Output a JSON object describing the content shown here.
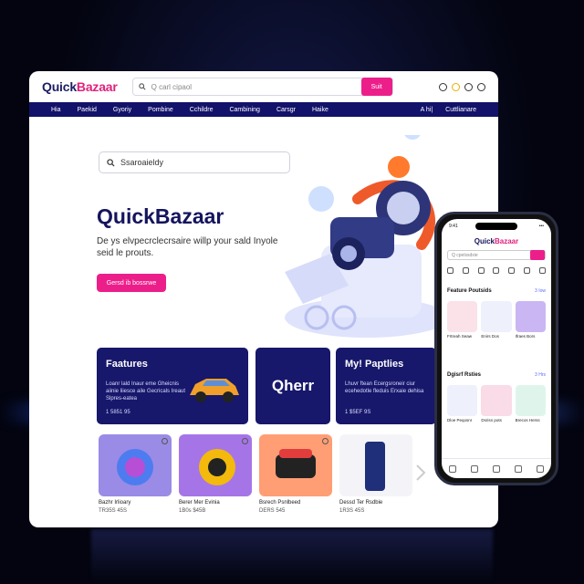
{
  "brand": {
    "name_dark": "Quick",
    "name_pink": "Bazaar",
    "accent": "#ec1f8a",
    "navy": "#17176b"
  },
  "topbar": {
    "search_placeholder": "Q carl cipaol",
    "search_button": "Suit",
    "icons": [
      "user-icon",
      "lightbulb-icon",
      "cart-icon",
      "help-icon"
    ]
  },
  "nav": {
    "items": [
      "Hia",
      "Paekid",
      "Gyoriy",
      "Pombine",
      "Cchildre",
      "Cambining",
      "Carsgr",
      "Haike"
    ],
    "right": [
      "A hi|",
      "Cuttlianare"
    ]
  },
  "hero": {
    "search_text": "Ssaroaieldy",
    "title": "QuickBazaar",
    "subtitle": "De ys elvpecrclecrsaire willp your sald Inyole seid le prouts.",
    "button": "Gersd ib bossrwe"
  },
  "features": [
    {
      "title": "Faatures",
      "text": "Loanr lald Inaur eme Gheicnis aiinie liiesce aile Gecricals Ireaut Slpres-eatea",
      "meta": "1 5851 95"
    },
    {
      "title": "Qherr"
    },
    {
      "title": "My! Paptlies",
      "text": "Lhuvr ftean Ecergsroneir ciur ecehedotle fleduis Erxaie dehisa",
      "meta": "1 $5EF 9S"
    }
  ],
  "products": [
    {
      "title": "Bazhr Irlioary",
      "price": "TR35S 45S",
      "color": "#9a8be6"
    },
    {
      "title": "Berer Mer Evinia",
      "price": "1B0s $45B",
      "color": "#a575e8"
    },
    {
      "title": "Bsrech Psnlbeed",
      "price": "DERS 545",
      "color": "#ff9e74"
    },
    {
      "title": "Dessd Ter Rsdbie",
      "price": "1R3S 45S",
      "color": "#f4f4f8"
    }
  ],
  "phone": {
    "status_time": "9:41",
    "status_right": "•••",
    "search_placeholder": "Q cpelssdxie",
    "section1": "Feature Poutsids",
    "section1_link": "3 Iow",
    "section1_items": [
      "Frtreah Seaw",
      "Enirs Dos",
      "Ifraes Bors"
    ],
    "section2": "Dgisrf Rsties",
    "section2_link": "3 Hrs",
    "section2_items": [
      "Dloe Peqosnr",
      "Dsrisn pots",
      "Brecos Herss"
    ]
  }
}
